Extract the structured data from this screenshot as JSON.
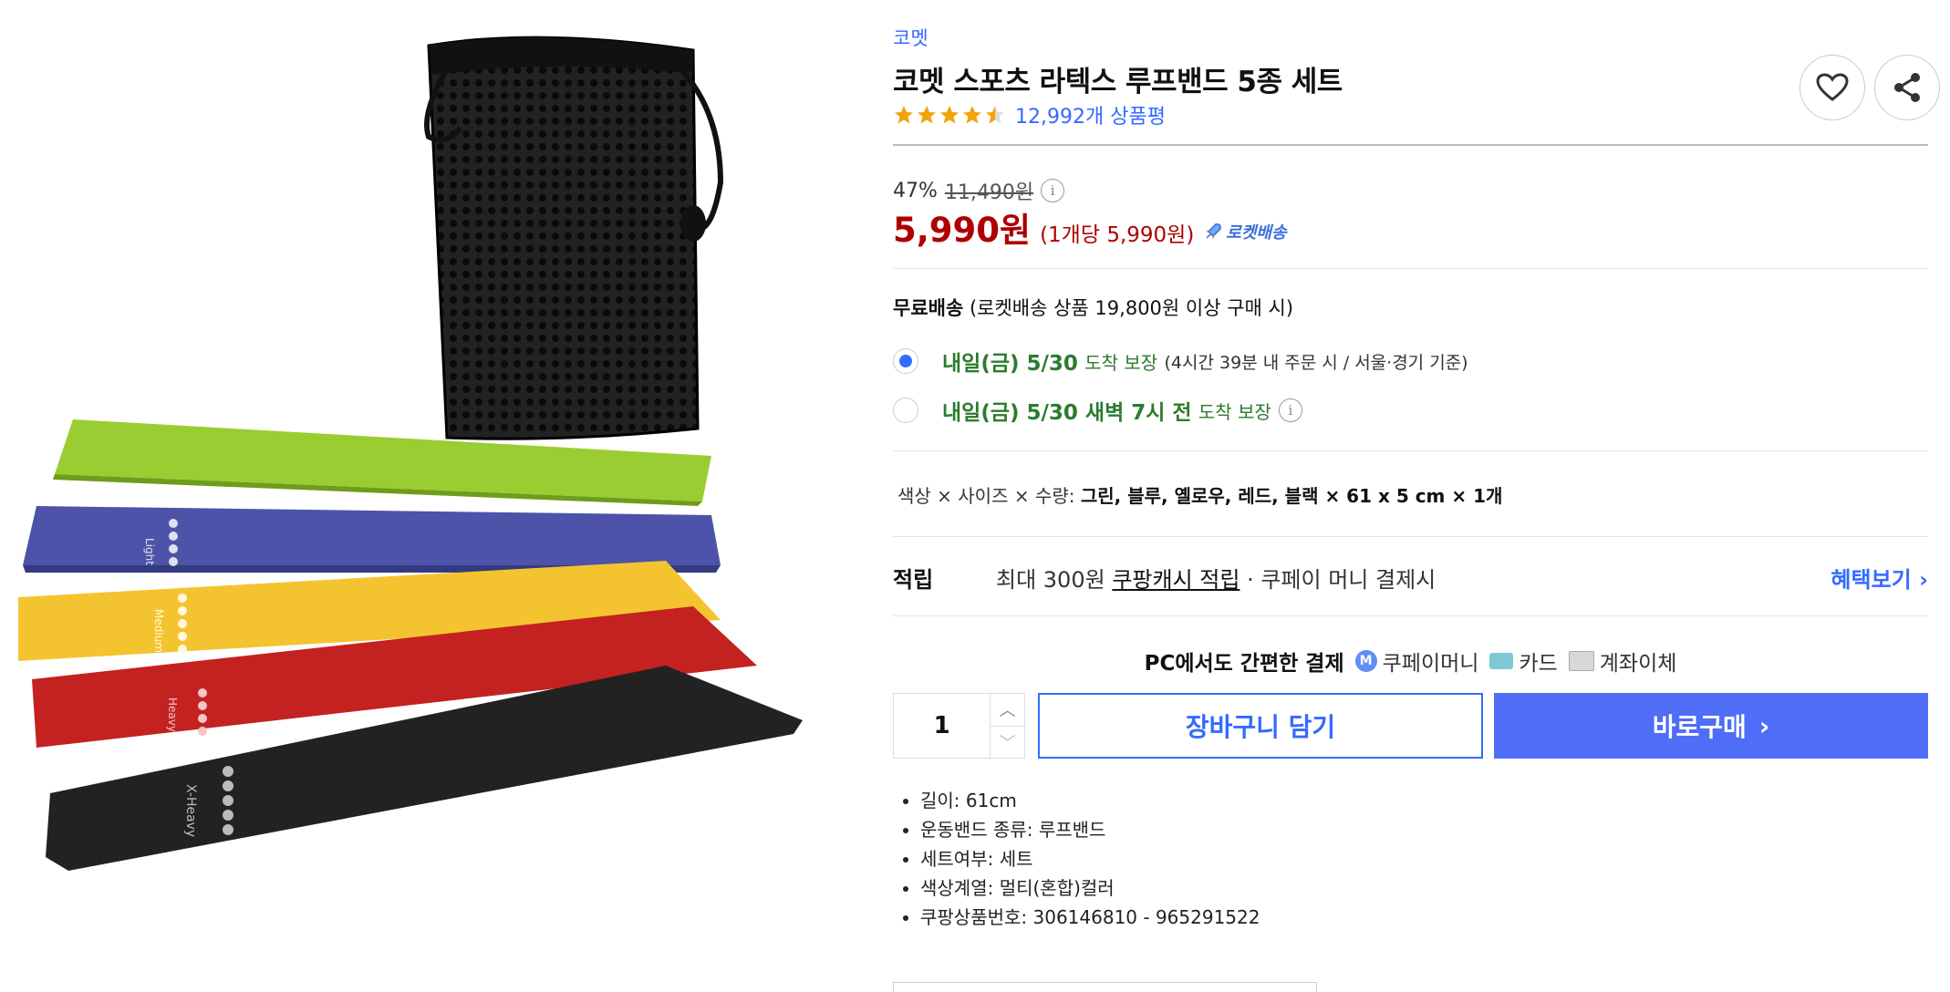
{
  "product": {
    "brand": "코멧",
    "title": "코멧 스포츠 라텍스 루프밴드 5종 세트",
    "rating_stars": 4.5,
    "review_count": "12,992개 상품평"
  },
  "price": {
    "discount_rate": "47%",
    "original_price": "11,490원",
    "sale_price": "5,990원",
    "unit_price": "(1개당 5,990원)",
    "rocket_label": "로켓배송"
  },
  "shipping": {
    "free_label": "무료배송",
    "free_condition": "(로켓배송 상품 19,800원 이상 구매 시)",
    "options": [
      {
        "date": "내일(금) 5/30",
        "suffix": "도착 보장",
        "note": "(4시간 39분 내 주문 시 / 서울·경기 기준)",
        "selected": true
      },
      {
        "date": "내일(금) 5/30 새벽 7시 전",
        "suffix": "도착 보장",
        "note": "",
        "selected": false
      }
    ]
  },
  "option": {
    "label": "색상 × 사이즈 × 수량:",
    "value": "그린, 블루, 옐로우, 레드, 블랙 × 61 x 5 cm × 1개"
  },
  "points": {
    "label": "적립",
    "prefix": "최대 300원",
    "link": "쿠팡캐시 적립",
    "suffix": "· 쿠페이 머니 결제시",
    "benefit_button": "혜택보기"
  },
  "payment": {
    "title": "PC에서도 간편한 결제",
    "methods": [
      "쿠페이머니",
      "카드",
      "계좌이체"
    ]
  },
  "purchase": {
    "quantity": "1",
    "cart_label": "장바구니 담기",
    "buy_label": "바로구매"
  },
  "specs": [
    "길이: 61cm",
    "운동밴드 종류: 루프밴드",
    "세트여부: 세트",
    "색상계열: 멀티(혼합)컬러",
    "쿠팡상품번호: 306146810 - 965291522"
  ],
  "band_labels": [
    "Light",
    "Medium",
    "Heavy",
    "X-Heavy"
  ],
  "colors": {
    "accent": "#346aff",
    "price_red": "#ae0000",
    "delivery_green": "#2c7b2e",
    "buy_button": "#4f6df6",
    "band_green": "#9acd32",
    "band_blue": "#4c53a8",
    "band_yellow": "#f4c430",
    "band_red": "#c42121",
    "band_black": "#222222"
  },
  "icons": [
    "heart-icon",
    "share-icon",
    "star-icon",
    "info-icon",
    "rocket-icon",
    "coupay-icon",
    "card-icon",
    "bank-icon",
    "chevron-right-icon",
    "chevron-up-icon",
    "chevron-down-icon"
  ]
}
